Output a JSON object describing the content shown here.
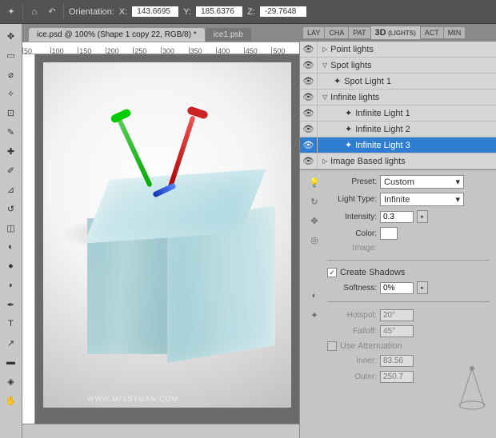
{
  "topbar": {
    "orientation_label": "Orientation:",
    "x_label": "X:",
    "x": "143.6695",
    "y_label": "Y:",
    "y": "185.6376",
    "z_label": "Z:",
    "z": "-29.7648"
  },
  "tabs": {
    "active": "ice.psd @ 100% (Shape 1 copy 22, RGB/8) *",
    "inactive": "ice1.psb"
  },
  "ruler": [
    "50",
    "100",
    "150",
    "200",
    "250",
    "300",
    "350",
    "400",
    "450",
    "500"
  ],
  "watermark": "WWW.MISSYUAN.COM",
  "status": "",
  "panel_tabs": [
    "LAY",
    "CHA",
    "PAT",
    "3D",
    "(LIGHTS)",
    "ACT",
    "MIN"
  ],
  "lights": {
    "point": "Point lights",
    "spot": "Spot lights",
    "spot1": "Spot Light 1",
    "infinite": "Infinite lights",
    "inf1": "Infinite Light 1",
    "inf2": "Infinite Light 2",
    "inf3": "Infinite Light 3",
    "image_based": "Image Based lights"
  },
  "props": {
    "preset_label": "Preset:",
    "preset": "Custom",
    "type_label": "Light Type:",
    "type": "Infinite",
    "intensity_label": "Intensity:",
    "intensity": "0.3",
    "color_label": "Color:",
    "image_label": "Image:",
    "create_shadows": "Create Shadows",
    "softness_label": "Softness:",
    "softness": "0%",
    "hotspot_label": "Hotspot:",
    "hotspot": "20°",
    "falloff_label": "Falloff:",
    "falloff": "45°",
    "use_atten": "Use Attenuation",
    "inner_label": "Inner:",
    "inner": "83.56",
    "outer_label": "Outer:",
    "outer": "250.7"
  }
}
